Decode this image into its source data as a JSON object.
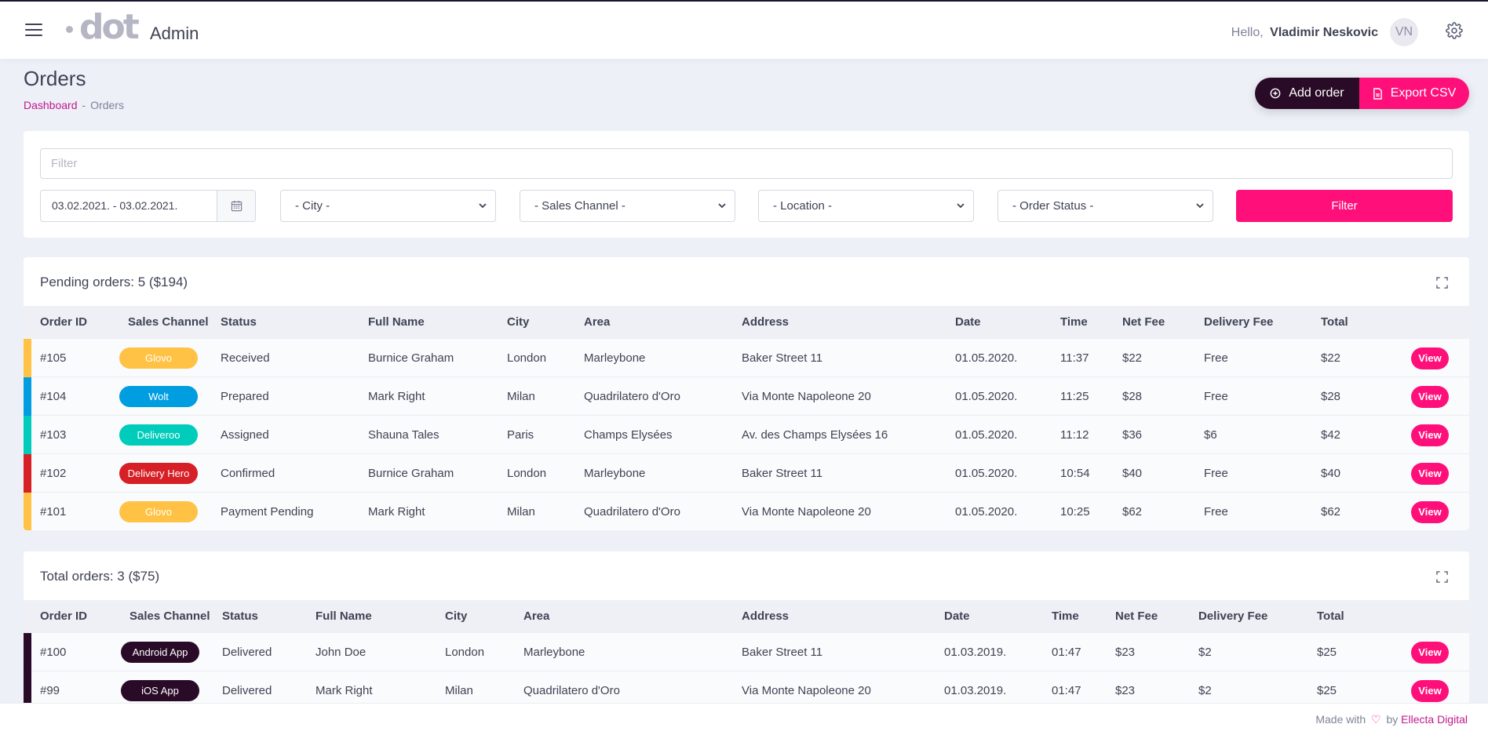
{
  "header": {
    "brand": "dot",
    "admin_label": "Admin",
    "hello": "Hello,",
    "user_name": "Vladimir Neskovic",
    "avatar_initials": "VN"
  },
  "page": {
    "title": "Orders",
    "breadcrumb": [
      "Dashboard",
      "Orders"
    ]
  },
  "actions": {
    "add_order": "Add order",
    "export_csv": "Export CSV"
  },
  "filters": {
    "filter_placeholder": "Filter",
    "date_range": "03.02.2021. - 03.02.2021.",
    "city": "- City -",
    "sales_channel": "- Sales Channel -",
    "location": "- Location -",
    "order_status": "- Order Status -",
    "filter_button": "Filter"
  },
  "colors": {
    "Glovo": "#ffc244",
    "Wolt": "#009de0",
    "Deliveroo": "#00ccbc",
    "Delivery Hero": "#d61f26",
    "Android App": "#2a0b27",
    "iOS App": "#2a0b27",
    "accent": "#ff0f7a"
  },
  "columns": [
    "Order ID",
    "Sales Channel",
    "Status",
    "Full Name",
    "City",
    "Area",
    "Address",
    "Date",
    "Time",
    "Net Fee",
    "Delivery Fee",
    "Total"
  ],
  "pending": {
    "title": "Pending orders: 5 ($194)",
    "rows": [
      {
        "id": "#105",
        "channel": "Glovo",
        "status": "Received",
        "name": "Burnice Graham",
        "city": "London",
        "area": "Marleybone",
        "address": "Baker Street 11",
        "date": "01.05.2020.",
        "time": "11:37",
        "net": "$22",
        "delivery": "Free",
        "total": "$22"
      },
      {
        "id": "#104",
        "channel": "Wolt",
        "status": "Prepared",
        "name": "Mark Right",
        "city": "Milan",
        "area": "Quadrilatero d'Oro",
        "address": "Via Monte Napoleone 20",
        "date": "01.05.2020.",
        "time": "11:25",
        "net": "$28",
        "delivery": "Free",
        "total": "$28"
      },
      {
        "id": "#103",
        "channel": "Deliveroo",
        "status": "Assigned",
        "name": "Shauna Tales",
        "city": "Paris",
        "area": "Champs Elysées",
        "address": "Av. des Champs Elysées 16",
        "date": "01.05.2020.",
        "time": "11:12",
        "net": "$36",
        "delivery": "$6",
        "total": "$42"
      },
      {
        "id": "#102",
        "channel": "Delivery Hero",
        "status": "Confirmed",
        "name": "Burnice Graham",
        "city": "London",
        "area": "Marleybone",
        "address": "Baker Street 11",
        "date": "01.05.2020.",
        "time": "10:54",
        "net": "$40",
        "delivery": "Free",
        "total": "$40"
      },
      {
        "id": "#101",
        "channel": "Glovo",
        "status": "Payment Pending",
        "name": "Mark Right",
        "city": "Milan",
        "area": "Quadrilatero d'Oro",
        "address": "Via Monte Napoleone 20",
        "date": "01.05.2020.",
        "time": "10:25",
        "net": "$62",
        "delivery": "Free",
        "total": "$62"
      }
    ]
  },
  "total": {
    "title": "Total orders: 3 ($75)",
    "rows": [
      {
        "id": "#100",
        "channel": "Android App",
        "status": "Delivered",
        "name": "John Doe",
        "city": "London",
        "area": "Marleybone",
        "address": "Baker Street 11",
        "date": "01.03.2019.",
        "time": "01:47",
        "net": "$23",
        "delivery": "$2",
        "total": "$25"
      },
      {
        "id": "#99",
        "channel": "iOS App",
        "status": "Delivered",
        "name": "Mark Right",
        "city": "Milan",
        "area": "Quadrilatero d'Oro",
        "address": "Via Monte Napoleone 20",
        "date": "01.03.2019.",
        "time": "01:47",
        "net": "$23",
        "delivery": "$2",
        "total": "$25"
      }
    ]
  },
  "view_label": "View",
  "footer": {
    "made_with": "Made with",
    "by": "by",
    "company": "Ellecta Digital"
  }
}
